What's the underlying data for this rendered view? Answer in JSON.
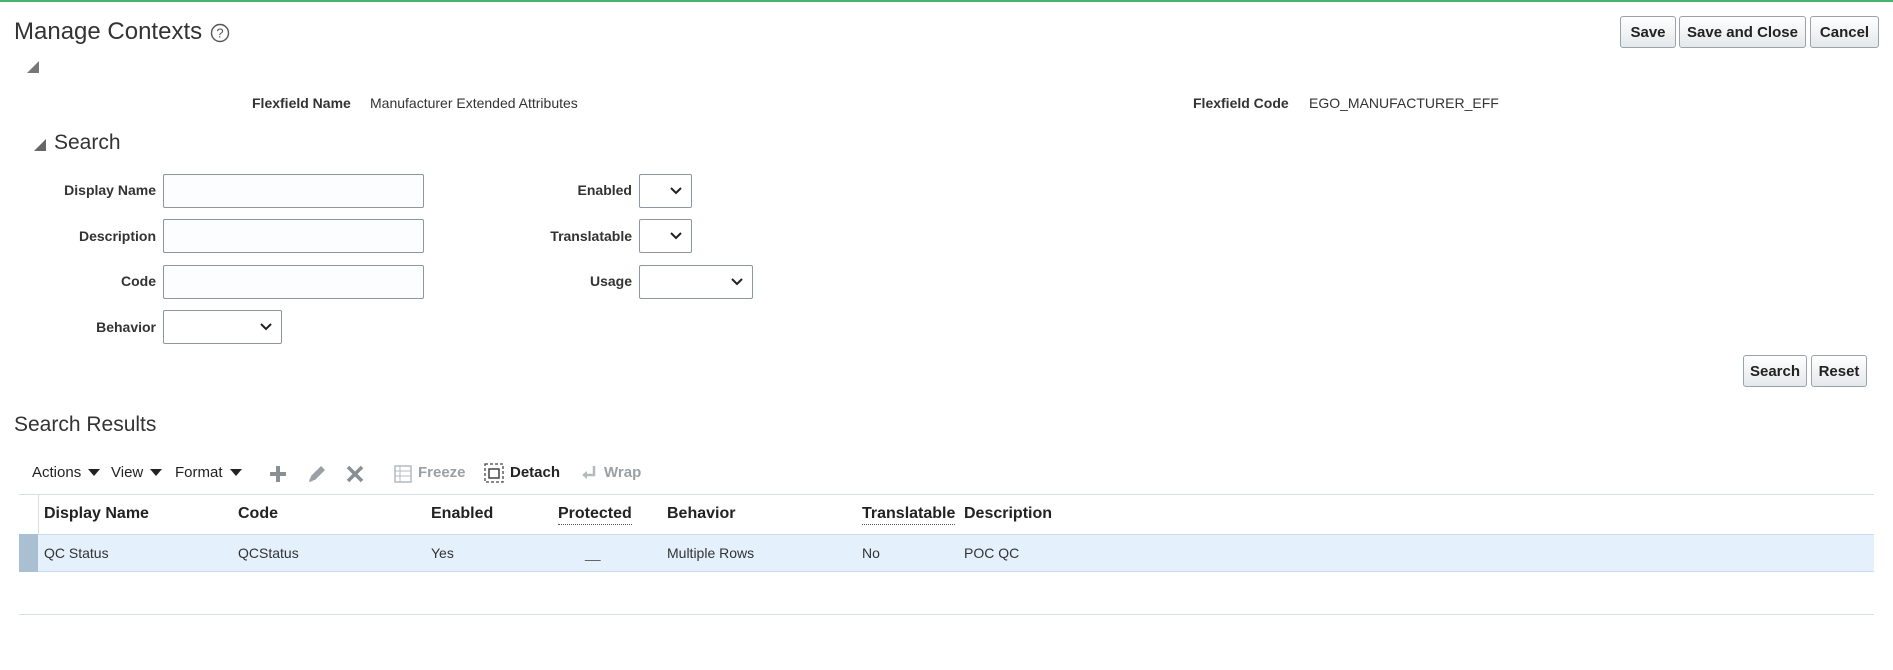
{
  "page": {
    "title": "Manage Contexts",
    "buttons": {
      "save": "Save",
      "save_close": "Save and Close",
      "cancel": "Cancel"
    }
  },
  "flexfield": {
    "name_label": "Flexfield Name",
    "name_value": "Manufacturer Extended Attributes",
    "code_label": "Flexfield Code",
    "code_value": "EGO_MANUFACTURER_EFF"
  },
  "search": {
    "title": "Search",
    "fields": {
      "display_name": {
        "label": "Display Name",
        "value": ""
      },
      "description": {
        "label": "Description",
        "value": ""
      },
      "code": {
        "label": "Code",
        "value": ""
      },
      "behavior": {
        "label": "Behavior",
        "value": ""
      },
      "enabled": {
        "label": "Enabled",
        "value": ""
      },
      "translatable": {
        "label": "Translatable",
        "value": ""
      },
      "usage": {
        "label": "Usage",
        "value": ""
      }
    },
    "buttons": {
      "search": "Search",
      "reset": "Reset"
    }
  },
  "results": {
    "title": "Search Results",
    "toolbar": {
      "actions": "Actions",
      "view": "View",
      "format": "Format",
      "freeze": "Freeze",
      "detach": "Detach",
      "wrap": "Wrap",
      "icons": [
        "plus-icon",
        "pencil-icon",
        "x-icon",
        "freeze-icon",
        "detach-icon",
        "wrap-icon"
      ]
    },
    "columns": [
      "Display Name",
      "Code",
      "Enabled",
      "Protected",
      "Behavior",
      "Translatable",
      "Description"
    ],
    "rows": [
      {
        "display_name": "QC Status",
        "code": "QCStatus",
        "enabled": "Yes",
        "protected": "__",
        "behavior": "Multiple Rows",
        "translatable": "No",
        "description": "POC QC"
      }
    ]
  },
  "colors": {
    "accent_top": "#47b36b",
    "selected_row": "#e4f0fb",
    "selected_marker": "#a9bfd2"
  }
}
